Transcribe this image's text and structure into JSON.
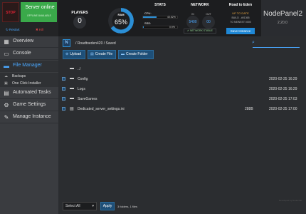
{
  "server": {
    "stop_label": "STOP",
    "status_title": "Server online",
    "status_sub": "OFFLINE AVAILABLE",
    "restart_label": "Restart",
    "kill_label": "Kill"
  },
  "stats": {
    "players_title": "PLAYERS",
    "players_value": "0",
    "ram_title": "RAM",
    "ram_value": "65%",
    "ram_fraction": 0.65,
    "stats_title": "STATS",
    "cpu_label": "CPU:",
    "cpu_pct": "40.52%",
    "cpu_fraction": 0.4052,
    "ssd_label": "SSD:",
    "ssd_pct": "0.9%",
    "ssd_fraction": 0.009,
    "network_title": "NETWORK",
    "in_label": "IN",
    "in_value": "5400",
    "out_label": "OUT",
    "out_value": "00",
    "net_status": "NETWORK STABLE",
    "game_title": "Road to Eden",
    "update_status": "UP TO DATE",
    "build_line": "BUILD - #01365",
    "build_sub": "TO NEWEST 0000",
    "save_label": "Save Instance"
  },
  "brand": {
    "name": "NodePanel2",
    "version": "2.20.0"
  },
  "nav": {
    "overview": "Overview",
    "console": "Console",
    "file_manager": "File Manager",
    "backups": "Backups",
    "one_click": "One Click Installer",
    "automated_tasks": "Automated Tasks",
    "game_settings": "Game Settings",
    "manage_instance": "Manage Instance"
  },
  "files": {
    "breadcrumb": "/  Roadtoeden420  /  Saved",
    "upload_label": "Upload",
    "create_file_label": "Create File",
    "create_folder_label": "Create Folder",
    "rows": [
      {
        "name": "../",
        "size": "",
        "date": "",
        "type": "folder"
      },
      {
        "name": "Config",
        "size": "",
        "date": "2020-02-25 16:29",
        "type": "folder"
      },
      {
        "name": "Logs",
        "size": "",
        "date": "2020-02-25 16:29",
        "type": "folder"
      },
      {
        "name": "SaveGames",
        "size": "",
        "date": "2020-02-25 17:03",
        "type": "folder"
      },
      {
        "name": "Dedicated_server_settings.ini",
        "size": "288B",
        "date": "2020-02-25 17:00",
        "type": "file"
      }
    ],
    "select_all_label": "Select All",
    "apply_label": "Apply",
    "count_text": "3 folders, 1 files",
    "credit": "Developed by Nodecraft"
  },
  "colors": {
    "accent": "#2b8fd6",
    "online": "#3aa94a",
    "warn": "#e8a640"
  }
}
